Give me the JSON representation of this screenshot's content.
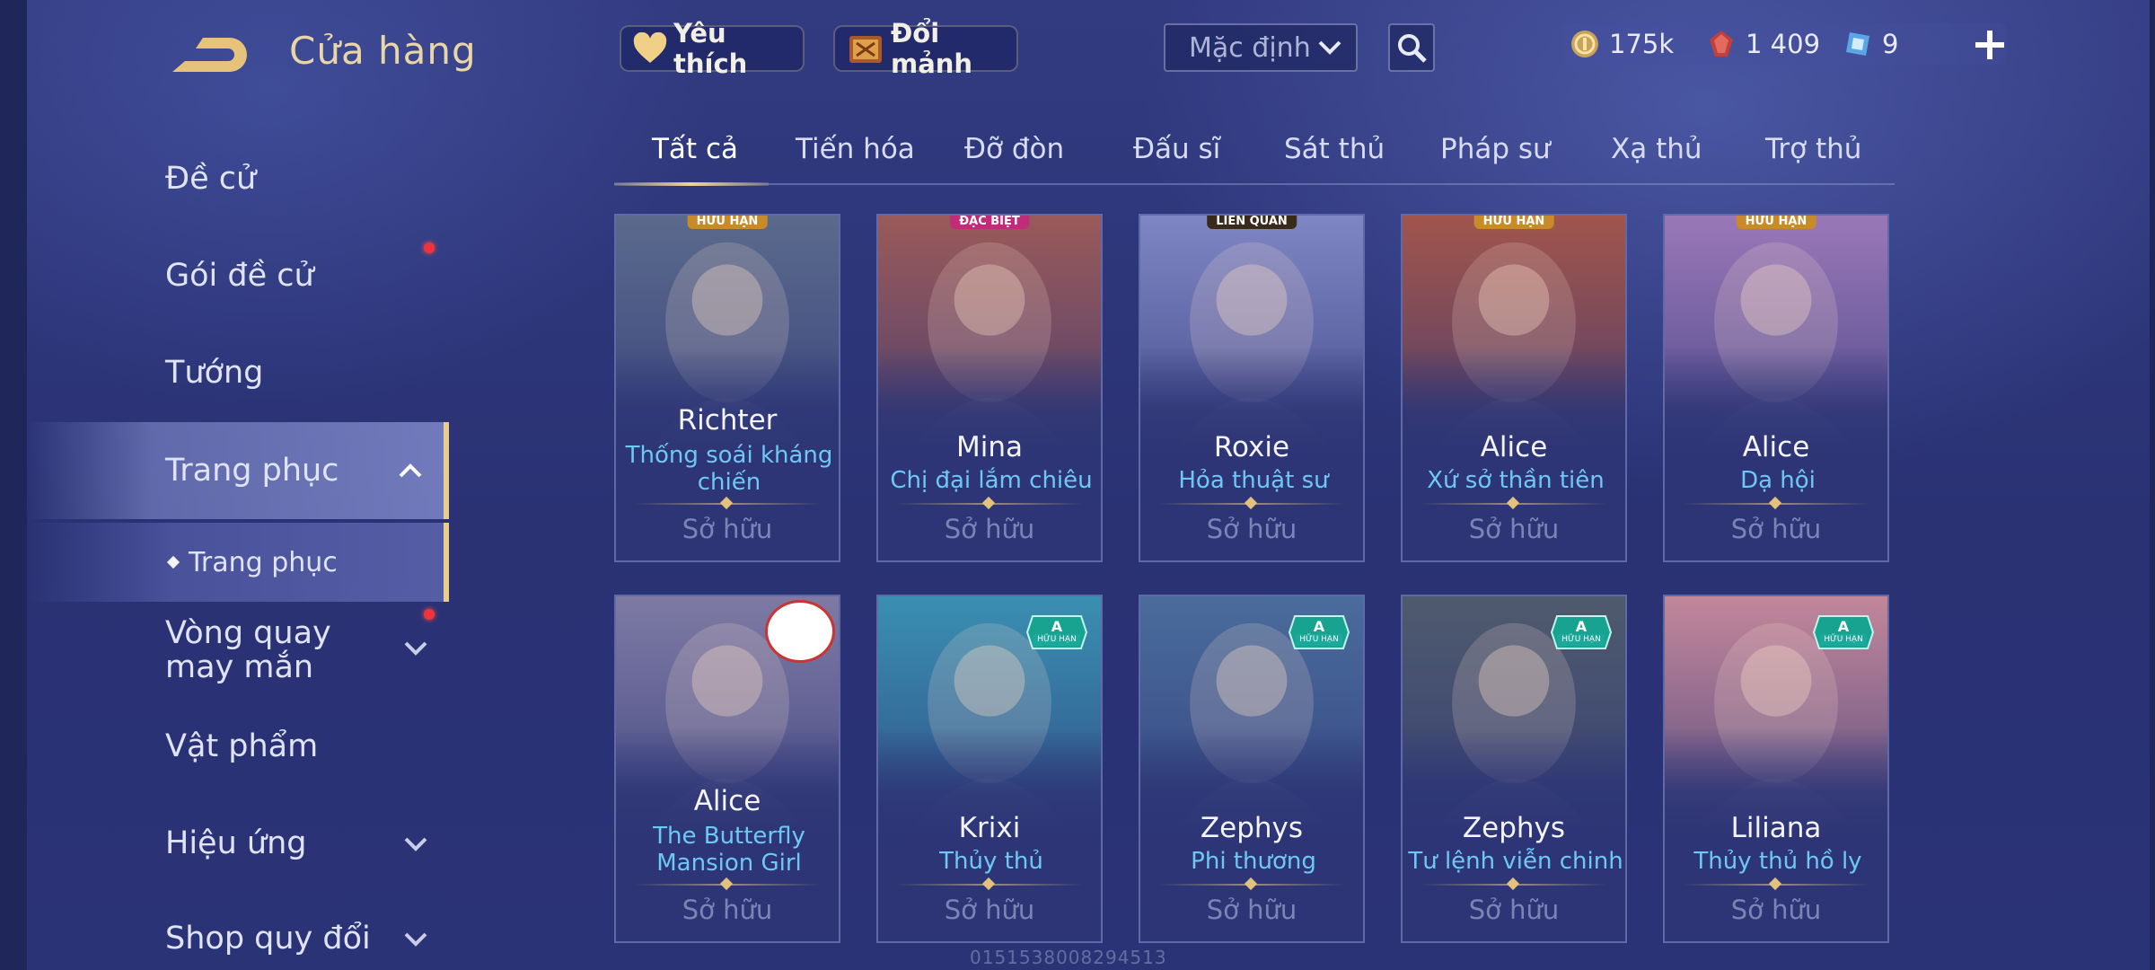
{
  "header": {
    "title": "Cửa hàng",
    "favorite_label": "Yêu thích",
    "exchange_label": "Đổi mảnh",
    "sort_value": "Mặc định",
    "currencies": {
      "gold": "175k",
      "ruby": "1 409",
      "ticket": "9"
    }
  },
  "sidebar": {
    "items": [
      {
        "label": "Đề cử"
      },
      {
        "label": "Gói đề cử"
      },
      {
        "label": "Tướng"
      },
      {
        "label": "Trang phục"
      },
      {
        "label": "Trang phục"
      },
      {
        "label": "Vòng quay may mắn"
      },
      {
        "label": "Vật phẩm"
      },
      {
        "label": "Hiệu ứng"
      },
      {
        "label": "Shop quy đổi"
      }
    ]
  },
  "tabs": [
    "Tất cả",
    "Tiến hóa",
    "Đỡ đòn",
    "Đấu sĩ",
    "Sát thủ",
    "Pháp sư",
    "Xạ thủ",
    "Trợ thủ"
  ],
  "cards": [
    {
      "hero": "Richter",
      "skin": "Thống soái kháng chiến",
      "status": "Sở hữu",
      "tag": "HỮU HẠN",
      "bg": "#5a6a8c"
    },
    {
      "hero": "Mina",
      "skin": "Chị đại lắm chiêu",
      "status": "Sở hữu",
      "tag": "ĐẶC BIỆT",
      "bg": "#9a5a5a"
    },
    {
      "hero": "Roxie",
      "skin": "Hỏa thuật sư",
      "status": "Sở hữu",
      "tag": "LIÊN QUÂN",
      "bg": "#7f86c4"
    },
    {
      "hero": "Alice",
      "skin": "Xứ sở thần tiên",
      "status": "Sở hữu",
      "tag": "HỮU HẠN",
      "bg": "#a1554d"
    },
    {
      "hero": "Alice",
      "skin": "Dạ hội",
      "status": "Sở hữu",
      "tag": "HỮU HẠN",
      "bg": "#9a78b8"
    },
    {
      "hero": "Alice",
      "skin": "The Butterfly Mansion Girl",
      "status": "Sở hữu",
      "tag": "",
      "bg": "#7e7aa4"
    },
    {
      "hero": "Krixi",
      "skin": "Thủy thủ",
      "status": "Sở hữu",
      "tag": "A HỮU HẠN",
      "bg": "#3a8fb2"
    },
    {
      "hero": "Zephys",
      "skin": "Phi thương",
      "status": "Sở hữu",
      "tag": "A HỮU HẠN",
      "bg": "#4a6c9c"
    },
    {
      "hero": "Zephys",
      "skin": "Tư lệnh viễn chinh",
      "status": "Sở hữu",
      "tag": "A HỮU HẠN",
      "bg": "#4f5a6e"
    },
    {
      "hero": "Liliana",
      "skin": "Thủy thủ hồ ly",
      "status": "Sở hữu",
      "tag": "A HỮU HẠN",
      "bg": "#c2879a"
    }
  ],
  "watermark": "0151538008294513"
}
